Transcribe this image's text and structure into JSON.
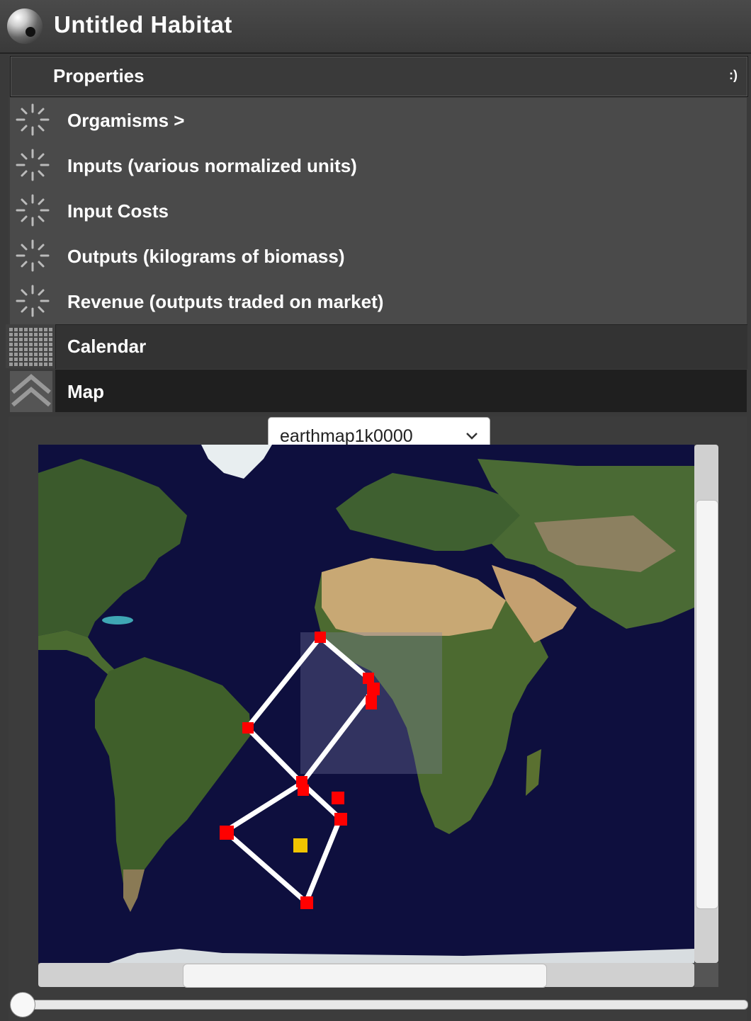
{
  "window": {
    "title": "Untitled Habitat"
  },
  "properties": {
    "label": "Properties",
    "menu_glyph": ":)"
  },
  "items": [
    {
      "label": "Orgamisms >"
    },
    {
      "label": "Inputs (various normalized units)"
    },
    {
      "label": "Input Costs"
    },
    {
      "label": "Outputs (kilograms of biomass)"
    },
    {
      "label": "Revenue (outputs traded on market)"
    }
  ],
  "calendar": {
    "label": "Calendar"
  },
  "map": {
    "label": "Map",
    "selected_map": "earthmap1k0000"
  },
  "colors": {
    "marker": "#ff0000",
    "highlight": "#f0c400",
    "route": "#ffffff",
    "ocean": "#0e0f3e"
  }
}
